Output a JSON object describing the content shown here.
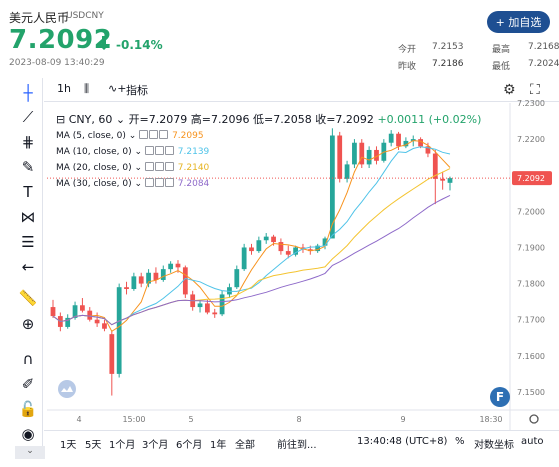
{
  "header": {
    "name": "美元人民币",
    "code": "USDCNY",
    "price": "7.2092",
    "change_pct": "-0.14%",
    "timestamp": "2023-08-09 13:40:29",
    "watch_button": "+ 加自选",
    "stats": [
      {
        "label": "今开",
        "value": "7.2153"
      },
      {
        "label": "最高",
        "value": "7.2168"
      },
      {
        "label": "昨收",
        "value": "7.2186"
      },
      {
        "label": "最低",
        "value": "7.2024"
      }
    ],
    "price_color": "#23a36b"
  },
  "toolbar": {
    "interval": "1h",
    "indicators_label": "指标"
  },
  "legend": {
    "symbol": "CNY, 60",
    "open": "开=7.2079",
    "high": "高=7.2096",
    "low": "低=7.2058",
    "close": "收=7.2092",
    "change": "+0.0011 (+0.02%)",
    "ma_rows": [
      {
        "label": "MA (5, close, 0)",
        "value": "7.2095",
        "color": "#f7931e"
      },
      {
        "label": "MA (10, close, 0)",
        "value": "7.2139",
        "color": "#4fc3e8"
      },
      {
        "label": "MA (20, close, 0)",
        "value": "7.2140",
        "color": "#f4c430"
      },
      {
        "label": "MA (30, close, 0)",
        "value": "7.2084",
        "color": "#8e6ac9"
      }
    ]
  },
  "chart_data": {
    "type": "candlestick",
    "x_ticks": [
      "4",
      "15:00",
      "5",
      "8",
      "9",
      "18:30"
    ],
    "y_ticks": [
      "7.2300",
      "7.2200",
      "7.2092",
      "7.2000",
      "7.1900",
      "7.1800",
      "7.1700",
      "7.1600",
      "7.1500"
    ],
    "y_range": [
      7.145,
      7.23
    ],
    "last_price": "7.2092",
    "up_color": "#26a69a",
    "down_color": "#ef5350",
    "candles": [
      [
        7.1735,
        7.1755,
        7.1705,
        7.171
      ],
      [
        7.171,
        7.172,
        7.1668,
        7.168
      ],
      [
        7.168,
        7.1715,
        7.1675,
        7.1705
      ],
      [
        7.1705,
        7.175,
        7.17,
        7.174
      ],
      [
        7.174,
        7.176,
        7.172,
        7.1725
      ],
      [
        7.1725,
        7.1735,
        7.1695,
        7.17
      ],
      [
        7.17,
        7.172,
        7.168,
        7.169
      ],
      [
        7.169,
        7.17,
        7.1668,
        7.1675
      ],
      [
        7.166,
        7.167,
        7.149,
        7.155
      ],
      [
        7.155,
        7.18,
        7.154,
        7.179
      ],
      [
        7.179,
        7.1805,
        7.177,
        7.1785
      ],
      [
        7.1785,
        7.183,
        7.178,
        7.182
      ],
      [
        7.182,
        7.183,
        7.179,
        7.18
      ],
      [
        7.18,
        7.184,
        7.179,
        7.183
      ],
      [
        7.183,
        7.1845,
        7.18,
        7.181
      ],
      [
        7.181,
        7.185,
        7.1805,
        7.184
      ],
      [
        7.184,
        7.1862,
        7.183,
        7.1855
      ],
      [
        7.1855,
        7.1865,
        7.183,
        7.1845
      ],
      [
        7.1845,
        7.185,
        7.176,
        7.177
      ],
      [
        7.177,
        7.178,
        7.1725,
        7.1735
      ],
      [
        7.1735,
        7.1755,
        7.172,
        7.1745
      ],
      [
        7.1745,
        7.1755,
        7.1715,
        7.172
      ],
      [
        7.172,
        7.173,
        7.1705,
        7.1715
      ],
      [
        7.1715,
        7.178,
        7.171,
        7.177
      ],
      [
        7.177,
        7.18,
        7.176,
        7.179
      ],
      [
        7.179,
        7.185,
        7.1785,
        7.184
      ],
      [
        7.184,
        7.191,
        7.1835,
        7.19
      ],
      [
        7.19,
        7.191,
        7.188,
        7.189
      ],
      [
        7.189,
        7.193,
        7.1885,
        7.192
      ],
      [
        7.192,
        7.194,
        7.191,
        7.193
      ],
      [
        7.193,
        7.1935,
        7.1905,
        7.1915
      ],
      [
        7.1915,
        7.1925,
        7.188,
        7.189
      ],
      [
        7.189,
        7.1905,
        7.187,
        7.188
      ],
      [
        7.188,
        7.1905,
        7.1875,
        7.19
      ],
      [
        7.19,
        7.191,
        7.1885,
        7.1895
      ],
      [
        7.1895,
        7.1905,
        7.188,
        7.189
      ],
      [
        7.189,
        7.191,
        7.1885,
        7.1905
      ],
      [
        7.1905,
        7.193,
        7.1895,
        7.1925
      ],
      [
        7.1925,
        7.223,
        7.206,
        7.221
      ],
      [
        7.221,
        7.222,
        7.208,
        7.209
      ],
      [
        7.209,
        7.214,
        7.208,
        7.213
      ],
      [
        7.213,
        7.22,
        7.212,
        7.219
      ],
      [
        7.219,
        7.22,
        7.212,
        7.213
      ],
      [
        7.213,
        7.218,
        7.212,
        7.217
      ],
      [
        7.217,
        7.218,
        7.213,
        7.214
      ],
      [
        7.214,
        7.22,
        7.2135,
        7.219
      ],
      [
        7.219,
        7.2225,
        7.218,
        7.2215
      ],
      [
        7.2215,
        7.222,
        7.217,
        7.218
      ],
      [
        7.218,
        7.2205,
        7.2175,
        7.2195
      ],
      [
        7.2195,
        7.221,
        7.218,
        7.22
      ],
      [
        7.22,
        7.2205,
        7.2175,
        7.218
      ],
      [
        7.218,
        7.219,
        7.215,
        7.216
      ],
      [
        7.216,
        7.217,
        7.202,
        7.209
      ],
      [
        7.209,
        7.211,
        7.206,
        7.2085
      ],
      [
        7.2079,
        7.2096,
        7.2058,
        7.2092
      ]
    ]
  },
  "bottom": {
    "ranges": [
      "1天",
      "5天",
      "1个月",
      "3个月",
      "6个月",
      "1年",
      "全部"
    ],
    "goto": "前往到...",
    "time": "13:40:48 (UTC+8)",
    "percent": "%",
    "log": "对数坐标",
    "auto": "auto"
  }
}
